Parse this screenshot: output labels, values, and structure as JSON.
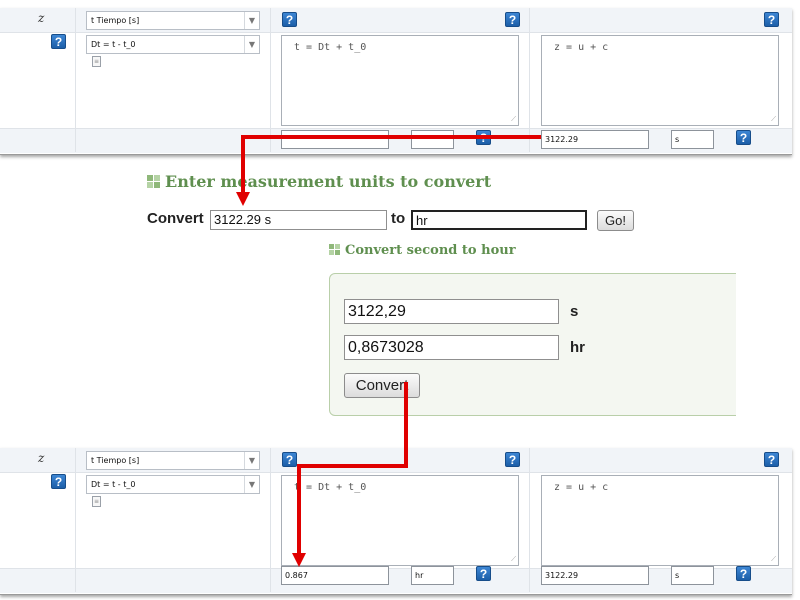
{
  "colors": {
    "arrow": "#e00000",
    "help_blue": "#2a72c6",
    "section_green": "#5f8f4f"
  },
  "top_panel": {
    "variable": "z",
    "time_select": "t Tiempo [s]",
    "offset_select": "Dt = t - t_0",
    "help_glyph": "?",
    "eq1": "t = Dt + t_0",
    "eq2": "z = u + c",
    "value1": "",
    "unit1": "",
    "value2": "3122.29",
    "unit2": "s"
  },
  "converter": {
    "title": "Enter measurement units to convert",
    "convert_label": "Convert",
    "from_value": "3122.29 s",
    "to_label": "to",
    "to_value": "hr",
    "go_label": "Go!",
    "subtitle": "Convert second to hour",
    "result_from_value": "3122,29",
    "result_from_unit": "s",
    "result_to_value": "0,8673028",
    "result_to_unit": "hr",
    "convert_button": "Convert"
  },
  "bottom_panel": {
    "variable": "z",
    "time_select": "t Tiempo [s]",
    "offset_select": "Dt = t - t_0",
    "help_glyph": "?",
    "eq1": "t = Dt + t_0",
    "eq2": "z = u + c",
    "value1": "0.867",
    "unit1": "hr",
    "value2": "3122.29",
    "unit2": "s"
  }
}
